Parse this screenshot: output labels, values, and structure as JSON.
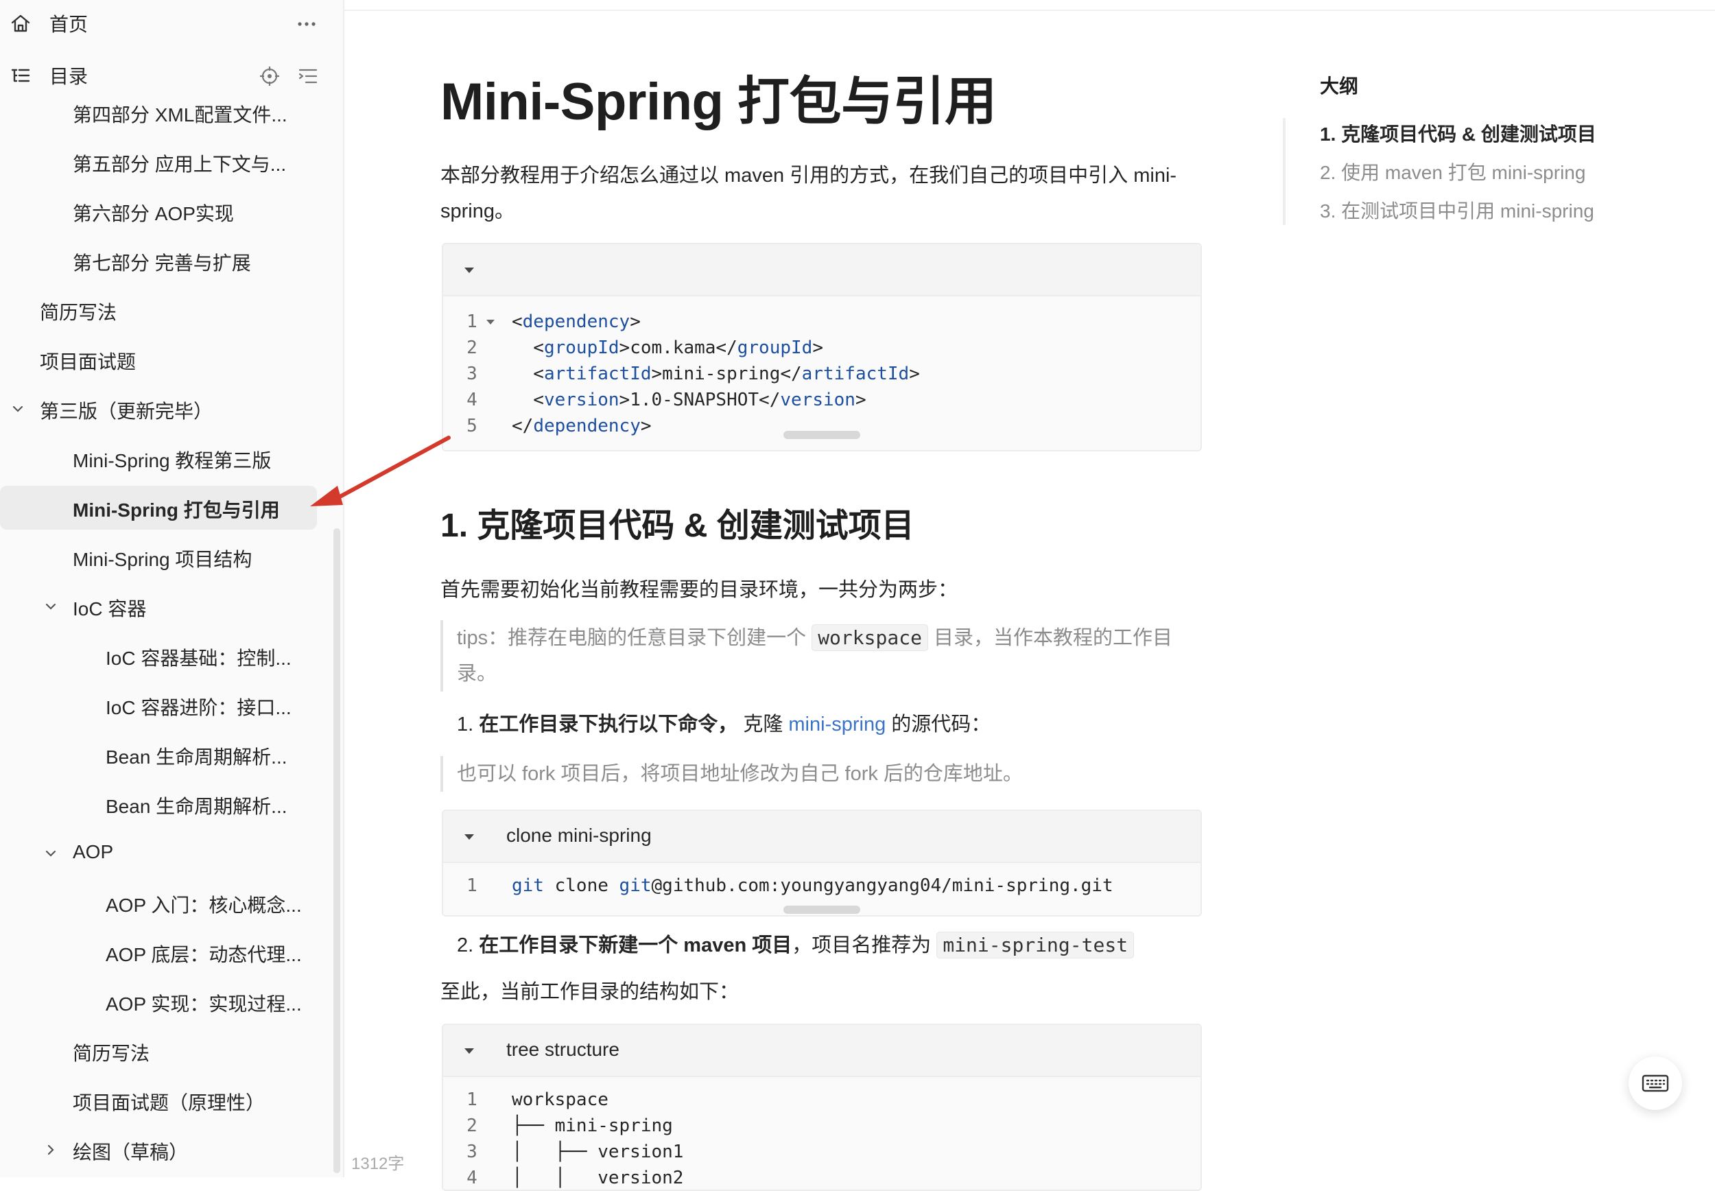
{
  "sidebar": {
    "home_label": "首页",
    "toc_label": "目录",
    "items": [
      {
        "label": "第四部分 XML配置文件..."
      },
      {
        "label": "第五部分 应用上下文与..."
      },
      {
        "label": "第六部分 AOP实现"
      },
      {
        "label": "第七部分 完善与扩展"
      },
      {
        "label": "简历写法"
      },
      {
        "label": "项目面试题"
      },
      {
        "label": "第三版（更新完毕）"
      },
      {
        "label": "Mini-Spring 教程第三版"
      },
      {
        "label": "Mini-Spring 打包与引用"
      },
      {
        "label": "Mini-Spring 项目结构"
      },
      {
        "label": "IoC 容器"
      },
      {
        "label": "IoC 容器基础：控制..."
      },
      {
        "label": "IoC 容器进阶：接口..."
      },
      {
        "label": "Bean 生命周期解析..."
      },
      {
        "label": "Bean 生命周期解析..."
      },
      {
        "label": "AOP"
      },
      {
        "label": "AOP 入门：核心概念..."
      },
      {
        "label": "AOP 底层：动态代理..."
      },
      {
        "label": "AOP 实现：实现过程..."
      },
      {
        "label": "简历写法"
      },
      {
        "label": "项目面试题（原理性）"
      },
      {
        "label": "绘图（草稿）"
      }
    ]
  },
  "status": {
    "word_count": "1312字"
  },
  "doc": {
    "title": "Mini-Spring 打包与引用",
    "intro": "本部分教程用于介绍怎么通过以 maven 引用的方式，在我们自己的项目中引入 mini-spring。",
    "code1": {
      "lines": [
        {
          "n": "1",
          "open": "<",
          "tag": "dependency",
          "close": ">",
          "text": "",
          "etag": ""
        },
        {
          "n": "2",
          "open": "  <",
          "tag": "groupId",
          "close": ">",
          "text": "com.kama</",
          "etag": "groupId"
        },
        {
          "n": "3",
          "open": "  <",
          "tag": "artifactId",
          "close": ">",
          "text": "mini-spring</",
          "etag": "artifactId"
        },
        {
          "n": "4",
          "open": "  <",
          "tag": "version",
          "close": ">",
          "text": "1.0-SNAPSHOT</",
          "etag": "version"
        },
        {
          "n": "5",
          "open": "</",
          "tag": "dependency",
          "close": ">",
          "text": "",
          "etag": ""
        }
      ]
    },
    "section1_title": "1. 克隆项目代码 & 创建测试项目",
    "para1": "首先需要初始化当前教程需要的目录环境，一共分为两步：",
    "tips_prefix": "tips：推荐在电脑的任意目录下创建一个",
    "tips_code": "workspace",
    "tips_suffix": "目录，当作本教程的工作目录。",
    "step1_num": "1.",
    "step1_bold": "在工作目录下执行以下命令，",
    "step1_mid": " 克隆 ",
    "step1_link": "mini-spring",
    "step1_end": " 的源代码：",
    "quote2": "也可以 fork 项目后，将项目地址修改为自己 fork 后的仓库地址。",
    "code2": {
      "title": "clone mini-spring",
      "line_no": "1",
      "kw1": "git",
      "mid": " clone ",
      "kw2": "git",
      "rest": "@github.com:youngyangyang04/mini-spring.git"
    },
    "step2_num": "2.",
    "step2_bold": "在工作目录下新建一个 maven 项目",
    "step2_mid": "，项目名推荐为",
    "step2_code": "mini-spring-test",
    "para2": "至此，当前工作目录的结构如下：",
    "code3": {
      "title": "tree structure",
      "lines": [
        {
          "n": "1",
          "text": "workspace"
        },
        {
          "n": "2",
          "text": "├── mini-spring"
        },
        {
          "n": "3",
          "text": "│   ├── version1"
        },
        {
          "n": "4",
          "text": "│   │   version2"
        }
      ]
    }
  },
  "outline": {
    "title": "大纲",
    "items": [
      {
        "label": "1. 克隆项目代码 & 创建测试项目"
      },
      {
        "label": "2. 使用 maven 打包 mini-spring"
      },
      {
        "label": "3. 在测试项目中引用 mini-spring"
      }
    ]
  },
  "colors": {
    "accent_link": "#3b73c9",
    "annotation_arrow": "#d33a2c",
    "active_bg": "#ececec"
  }
}
